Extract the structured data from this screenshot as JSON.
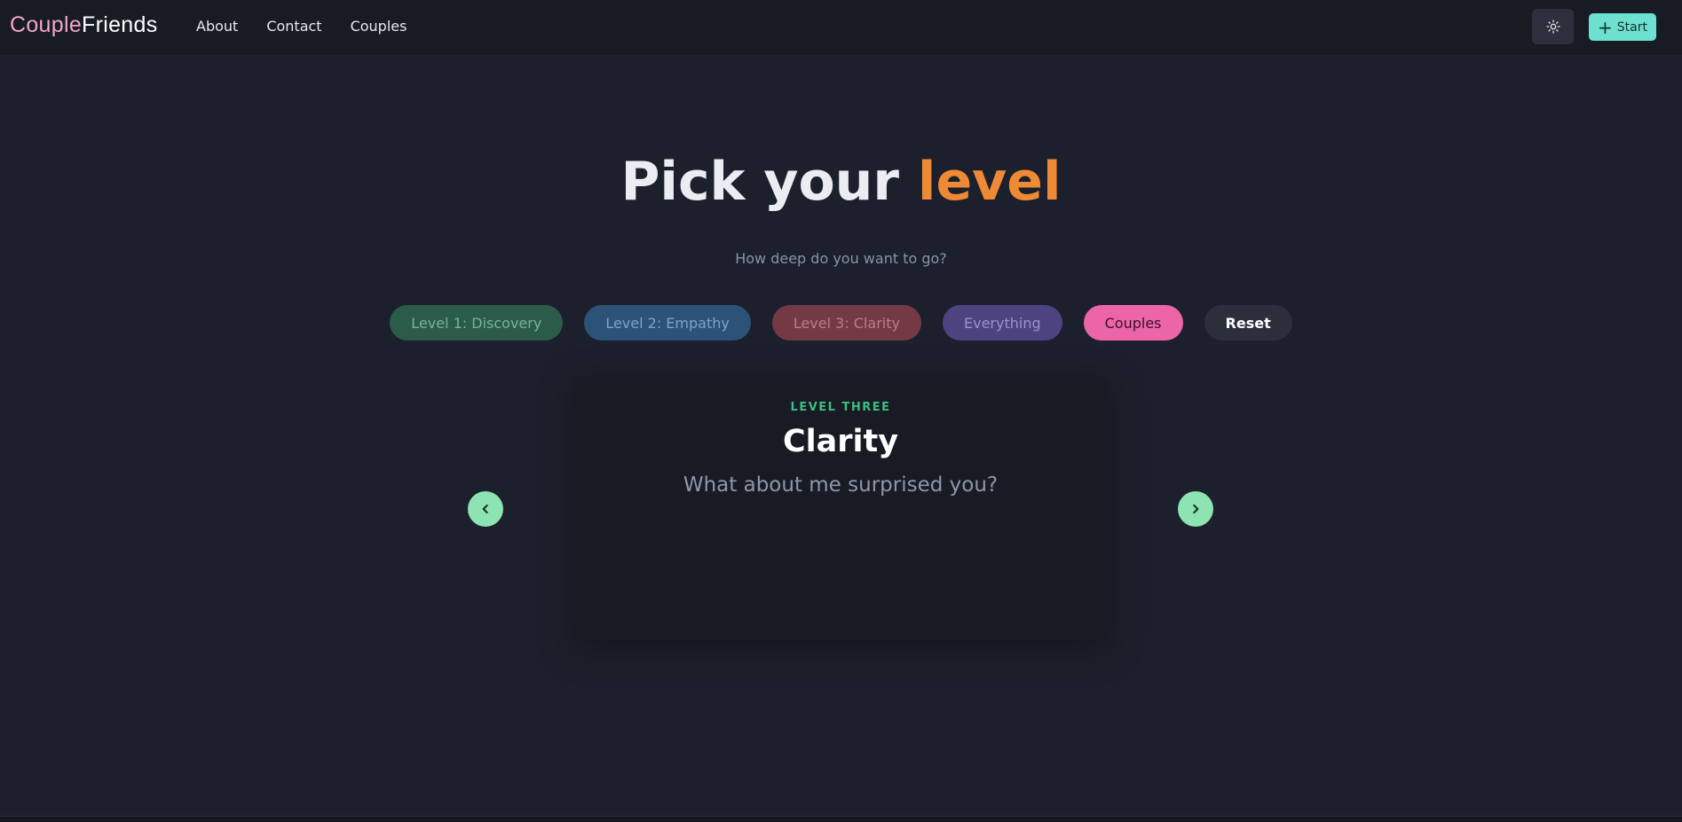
{
  "brand": {
    "part1": "Couple",
    "part2": "Friends"
  },
  "nav": {
    "links": [
      "About",
      "Contact",
      "Couples"
    ]
  },
  "header": {
    "start_label": "Start",
    "theme_icon": "sun-icon"
  },
  "hero": {
    "title_main": "Pick your ",
    "title_accent": "level",
    "subtitle": "How deep do you want to go?"
  },
  "filters": {
    "level1": "Level 1: Discovery",
    "level2": "Level 2: Empathy",
    "level3": "Level 3: Clarity",
    "everything": "Everything",
    "couples": "Couples",
    "reset": "Reset"
  },
  "card": {
    "level_label": "LEVEL THREE",
    "title": "Clarity",
    "question": "What about me surprised you?"
  },
  "colors": {
    "accent_orange": "#ee8a35",
    "start_teal": "#6ee0cf",
    "couples_pink": "#ec65a8",
    "arrow_green": "#8de3b1",
    "level_green": "#3bbf7f"
  }
}
